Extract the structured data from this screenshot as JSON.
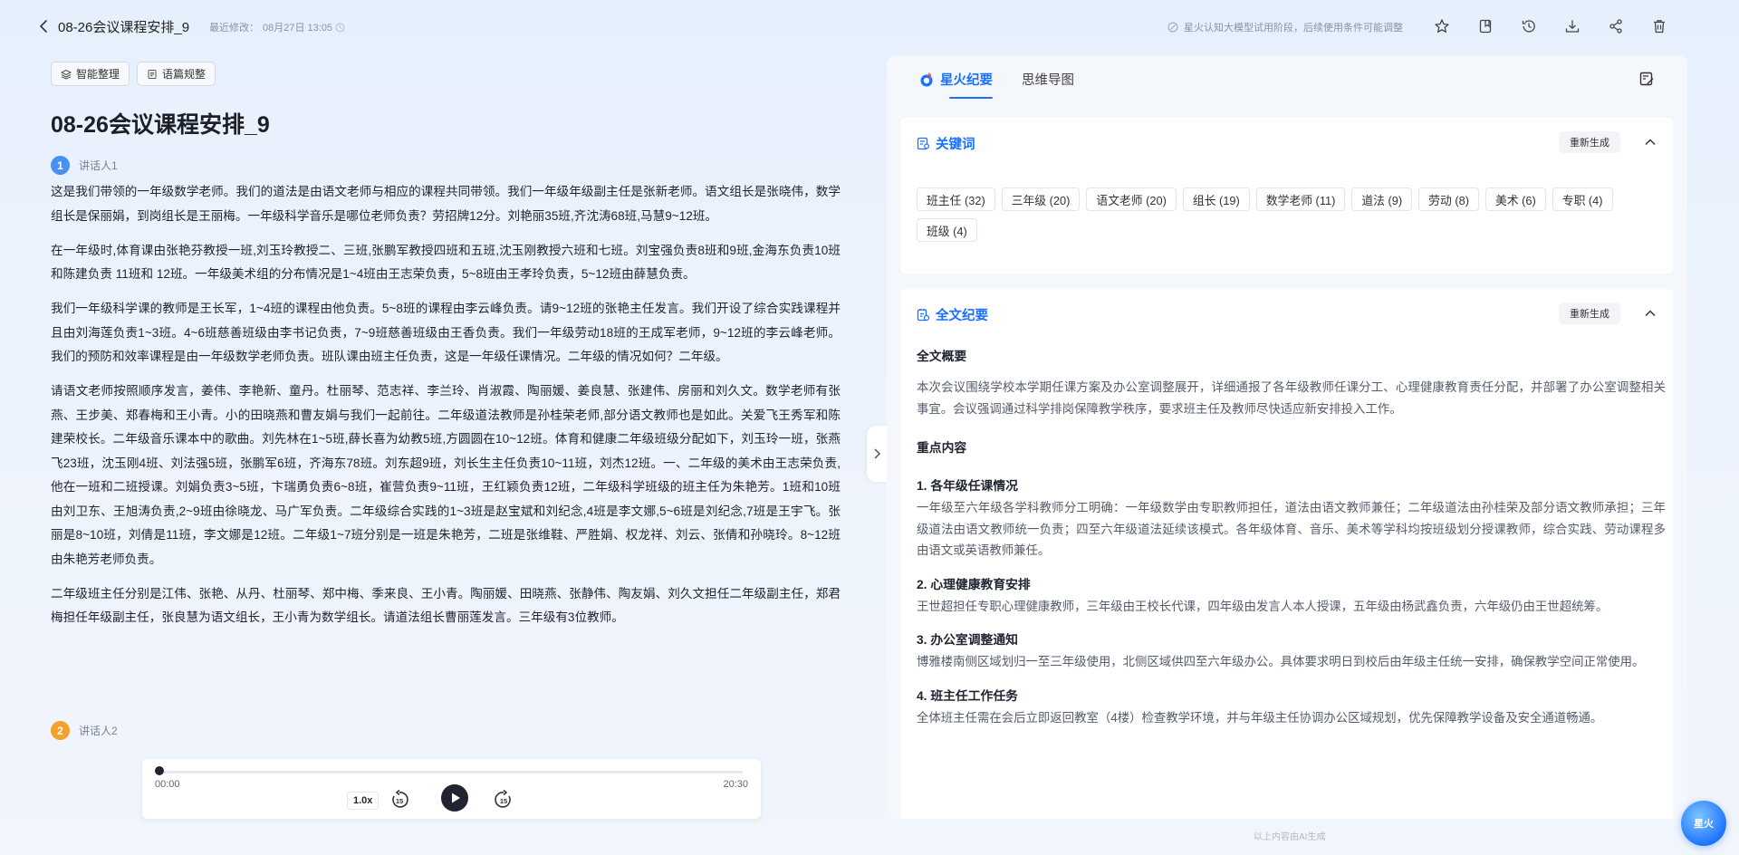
{
  "header": {
    "doc_title": "08-26会议课程安排_9",
    "last_modified_label": "最近修改：",
    "last_modified_value": "08月27日 13:05",
    "notice": "星火认知大模型试用阶段，后续使用条件可能调整"
  },
  "toolbar": {
    "smart_organize": "智能整理",
    "text_polish": "语篇规整"
  },
  "main": {
    "title": "08-26会议课程安排_9",
    "speaker1": {
      "num": "1",
      "name": "讲话人1",
      "color": "#4a90f2"
    },
    "speaker2": {
      "num": "2",
      "name": "讲话人2",
      "color": "#f5a029"
    },
    "paragraphs": [
      "这是我们带领的一年级数学老师。我们的道法是由语文老师与相应的课程共同带领。我们一年级年级副主任是张新老师。语文组长是张晓伟，数学组长是保丽娟，到岗组长是王丽梅。一年级科学音乐是哪位老师负责？劳招牌12分。刘艳丽35班,齐沈涛68班,马慧9~12班。",
      "在一年级时,体育课由张艳芬教授一班,刘玉玲教授二、三班,张鹏军教授四班和五班,沈玉刚教授六班和七班。刘宝强负责8班和9班,金海东负责10班和陈建负责 11班和 12班。一年级美术组的分布情况是1~4班由王志荣负责，5~8班由王孝玲负责，5~12班由薛慧负责。",
      "我们一年级科学课的教师是王长军，1~4班的课程由他负责。5~8班的课程由李云峰负责。请9~12班的张艳主任发言。我们开设了综合实践课程并且由刘海莲负责1~3班。4~6班慈善班级由李书记负责，7~9班慈善班级由王香负责。我们一年级劳动18班的王成军老师，9~12班的李云峰老师。我们的预防和效率课程是由一年级数学老师负责。班队课由班主任负责，这是一年级任课情况。二年级的情况如何？二年级。",
      "请语文老师按照顺序发言，姜伟、李艳新、童丹。杜丽琴、范志祥、李兰玲、肖淑霞、陶丽媛、姜良慧、张建伟、房丽和刘久文。数学老师有张燕、王步美、郑春梅和王小青。小的田晓燕和曹友娟与我们一起前往。二年级道法教师是孙桂荣老师,部分语文教师也是如此。关爱飞王秀军和陈建荣校长。二年级音乐课本中的歌曲。刘先林在1~5班,薛长喜为幼教5班,方圆圆在10~12班。体育和健康二年级班级分配如下，刘玉玲一班，张燕飞23班，沈玉刚4班、刘法强5班，张鹏军6班，齐海东78班。刘东超9班，刘长生主任负责10~11班，刘杰12班。一、二年级的美术由王志荣负责,他在一班和二班授课。刘娟负责3~5班，卞瑞勇负责6~8班，崔营负责9~11班，王红颖负责12班，二年级科学班级的班主任为朱艳芳。1班和10班由刘卫东、王旭涛负责,2~9班由徐晓龙、马广军负责。二年级综合实践的1~3班是赵宝斌和刘纪念,4班是李文娜,5~6班是刘纪念,7班是王宇飞。张丽是8~10班，刘倩是11班，李文娜是12班。二年级1~7班分别是一班是朱艳芳，二班是张维鞋、严胜娟、权龙祥、刘云、张倩和孙晓玲。8~12班由朱艳芳老师负责。",
      "二年级班主任分别是江伟、张艳、从丹、杜丽琴、郑中梅、季来良、王小青。陶丽媛、田晓燕、张静伟、陶友娟、刘久文担任二年级副主任，郑君梅担任年级副主任，张良慧为语文组长，王小青为数学组长。请道法组长曹丽莲发言。三年级有3位教师。"
    ]
  },
  "player": {
    "current_time": "00:00",
    "total_time": "20:30",
    "speed": "1.0x",
    "progress": 0
  },
  "right_panel": {
    "tab_active": "星火纪要",
    "tab_inactive": "思维导图",
    "keywords": {
      "title": "关键词",
      "regen": "重新生成",
      "tags": [
        "班主任 (32)",
        "三年级 (20)",
        "语文老师 (20)",
        "组长 (19)",
        "数学老师 (11)",
        "道法 (9)",
        "劳动 (8)",
        "美术 (6)",
        "专职 (4)",
        "班级 (4)"
      ]
    },
    "summary": {
      "title": "全文纪要",
      "regen": "重新生成",
      "overview_title": "全文概要",
      "overview": "本次会议围绕学校本学期任课方案及办公室调整展开，详细通报了各年级教师任课分工、心理健康教育责任分配，并部署了办公室调整相关事宜。会议强调通过科学排岗保障教学秩序，要求班主任及教师尽快适应新安排投入工作。",
      "key_title": "重点内容",
      "items": [
        {
          "heading": "1. 各年级任课情况",
          "text": "一年级至六年级各学科教师分工明确：一年级数学由专职教师担任，道法由语文教师兼任；二年级道法由孙桂荣及部分语文教师承担；三年级道法由语文教师统一负责；四至六年级道法延续该模式。各年级体育、音乐、美术等学科均按班级划分授课教师，综合实践、劳动课程多由语文或英语教师兼任。"
        },
        {
          "heading": "2. 心理健康教育安排",
          "text": "王世超担任专职心理健康教师，三年级由王校长代课，四年级由发言人本人授课，五年级由杨武鑫负责，六年级仍由王世超统筹。"
        },
        {
          "heading": "3. 办公室调整通知",
          "text": "博雅楼南侧区域划归一至三年级使用，北侧区域供四至六年级办公。具体要求明日到校后由年级主任统一安排，确保教学空间正常使用。"
        },
        {
          "heading": "4. 班主任工作任务",
          "text": "全体班主任需在会后立即返回教室（4楼）检查教学环境，并与年级主任协调办公区域规划，优先保障教学设备及安全通道畅通。"
        }
      ]
    },
    "footnote": "以上内容由AI生成",
    "mascot": "星火"
  },
  "colors": {
    "accent": "#1a6fff",
    "background": "#e9f1fd"
  }
}
